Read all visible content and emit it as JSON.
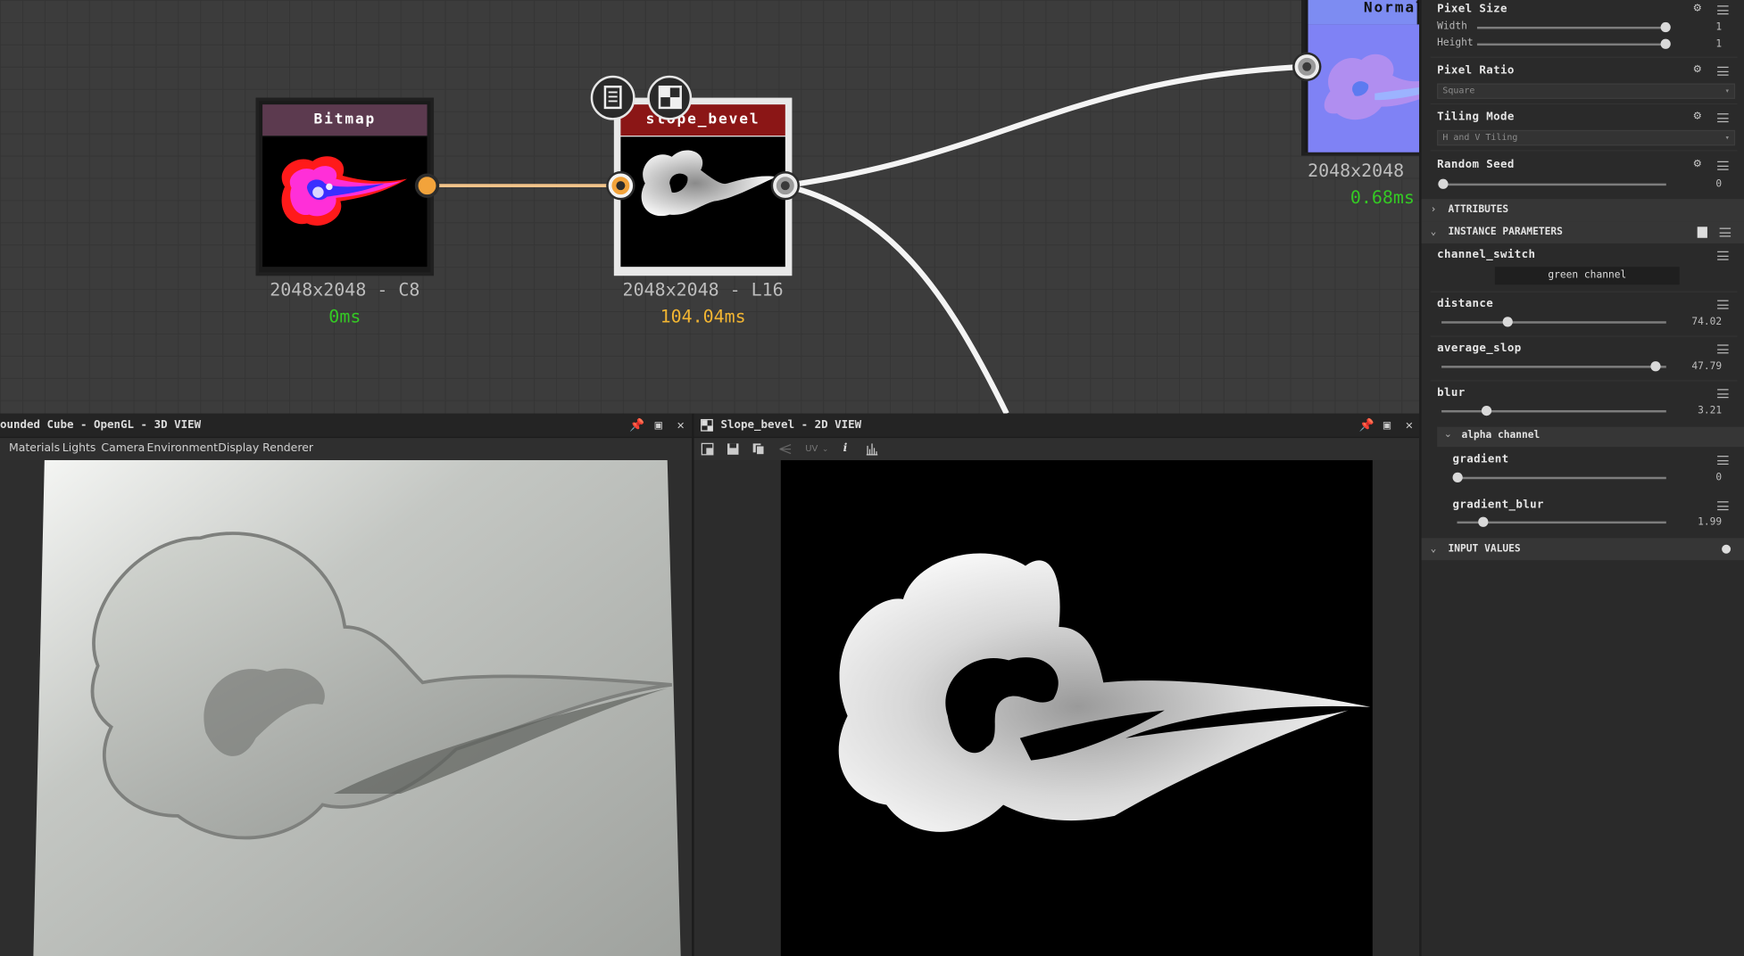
{
  "graph": {
    "nodes": [
      {
        "title": "Bitmap",
        "resolution": "2048x2048 - C8",
        "time": "0ms",
        "time_color": "#34c924",
        "header_color": "#5c3a4f"
      },
      {
        "title": "slope_bevel",
        "resolution": "2048x2048 - L16",
        "time": "104.04ms",
        "time_color": "#f2b532",
        "header_color": "#8b1616"
      },
      {
        "title": "Normal",
        "resolution": "2048x2048",
        "time": "0.68ms",
        "time_color": "#34c924",
        "header_color": "#6f7ff2"
      }
    ],
    "node_buttons": [
      {
        "icon": "document-icon"
      },
      {
        "icon": "checker-icon"
      }
    ]
  },
  "properties": {
    "pixel_size": {
      "title": "Pixel Size",
      "width_label": "Width",
      "width_value": "1",
      "height_label": "Height",
      "height_value": "1"
    },
    "pixel_ratio": {
      "title": "Pixel Ratio",
      "value": "Square"
    },
    "tiling_mode": {
      "title": "Tiling Mode",
      "value": "H and V Tiling"
    },
    "random_seed": {
      "title": "Random Seed",
      "value": "0"
    },
    "sections": {
      "attributes": "ATTRIBUTES",
      "instance_parameters": "INSTANCE PARAMETERS",
      "input_values": "INPUT VALUES"
    },
    "channel_switch": {
      "label": "channel_switch",
      "value": "green channel"
    },
    "distance": {
      "label": "distance",
      "value": "74.02",
      "fraction": 0.29
    },
    "average_slop": {
      "label": "average_slop",
      "value": "47.79",
      "fraction": 0.95
    },
    "blur": {
      "label": "blur",
      "value": "3.21",
      "fraction": 0.2
    },
    "alpha_channel": {
      "label": "alpha channel"
    },
    "gradient": {
      "label": "gradient",
      "value": "0",
      "fraction": 0.0
    },
    "gradient_blur": {
      "label": "gradient_blur",
      "value": "1.99",
      "fraction": 0.12
    }
  },
  "view3d": {
    "title": "ounded Cube - OpenGL - 3D VIEW",
    "menu": [
      "Materials",
      "Lights",
      "Camera",
      "Environment",
      "Display",
      "Renderer"
    ]
  },
  "view2d": {
    "title": "Slope_bevel - 2D VIEW",
    "uv_label": "UV",
    "info_label": "i"
  },
  "colors": {
    "accent_orange": "#f2a33b",
    "wire": "#f0f0f0",
    "wire_orange": "#f3c48a"
  }
}
